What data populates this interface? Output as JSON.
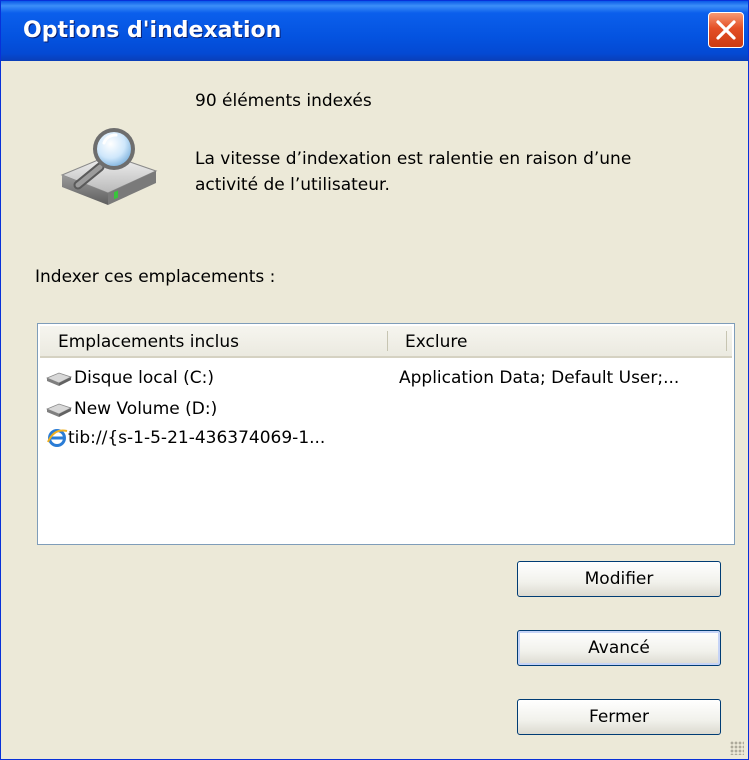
{
  "window": {
    "title": "Options d'indexation"
  },
  "status": {
    "count_text": "90 éléments indexés",
    "message": "La vitesse d’indexation est ralentie en raison d’une",
    "message_line2": "activité de l’utilisateur."
  },
  "locations": {
    "label": "Indexer ces emplacements :",
    "columns": [
      "Emplacements inclus",
      "Exclure"
    ],
    "rows": [
      {
        "name": "Disque local (C:)",
        "exclude": "Application Data; Default User;...",
        "icon": "drive-icon"
      },
      {
        "name": "New Volume (D:)",
        "exclude": "",
        "icon": "drive-icon"
      },
      {
        "name": "tib://{s-1-5-21-436374069-1...",
        "exclude": "",
        "icon": "ie-icon"
      }
    ]
  },
  "buttons": {
    "modify": "Modifier",
    "advanced": "Avancé",
    "close": "Fermer"
  },
  "colors": {
    "titlebar": "#0453E0",
    "dialog_bg": "#ECE9D8",
    "close_button": "#E44F25"
  }
}
